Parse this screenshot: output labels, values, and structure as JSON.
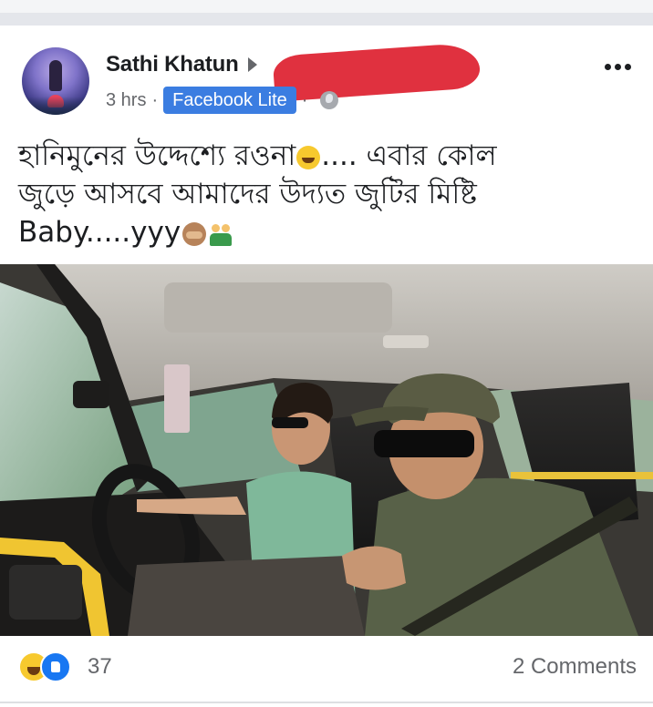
{
  "post": {
    "author": "Sathi Khatun",
    "time": "3 hrs",
    "separator": "·",
    "app_badge": "Facebook Lite",
    "text_lines": [
      "হানিমুনের উদ্দেশ্যে রওনা",
      ".... এবার কোল",
      "জুড়ে আসবে আমাদের উদ্যত জুটির মিষ্টি",
      "Baby.....yyy"
    ]
  },
  "reactions": {
    "count": "37",
    "comments": "2 Comments"
  },
  "icons": {
    "more": "more-options-icon",
    "arrow": "arrow-right-icon",
    "audience": "globe-icon",
    "haha": "haha-reaction-icon",
    "like": "like-reaction-icon"
  },
  "colors": {
    "badge": "#3b7de1",
    "redaction": "#e0313f",
    "like": "#1877f2",
    "haha": "#f7c92e"
  }
}
